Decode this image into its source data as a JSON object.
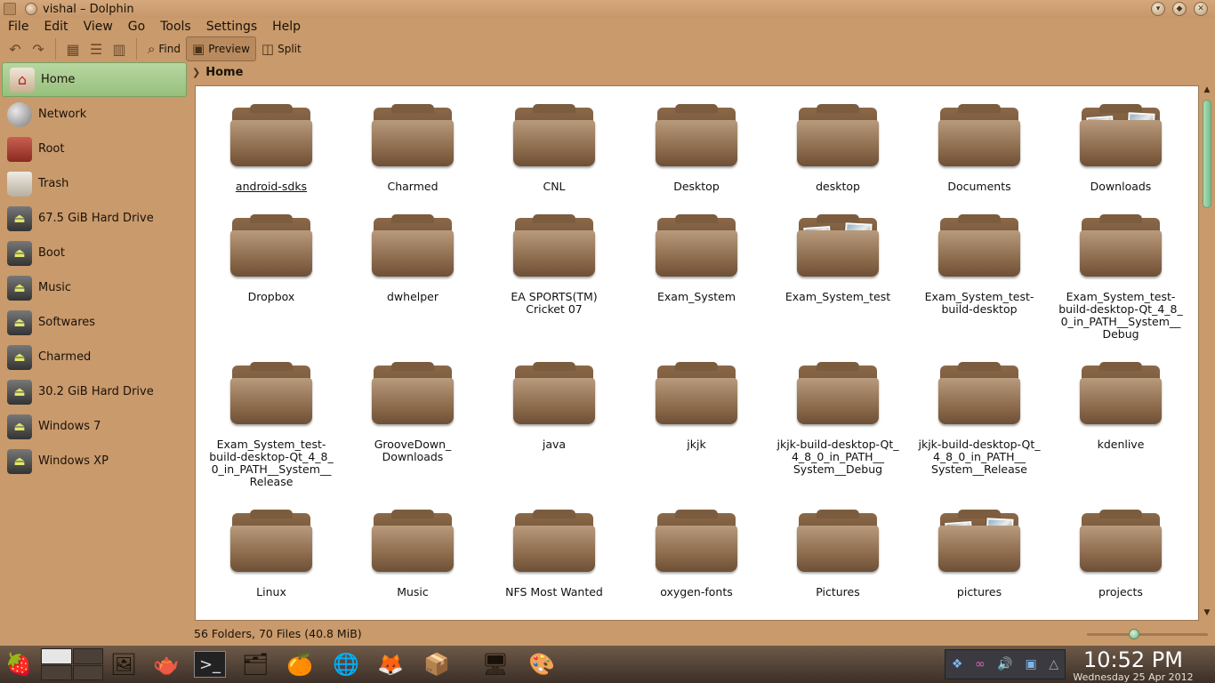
{
  "window": {
    "title": "vishal – Dolphin"
  },
  "menu": [
    "File",
    "Edit",
    "View",
    "Go",
    "Tools",
    "Settings",
    "Help"
  ],
  "toolbar": {
    "find": "Find",
    "preview": "Preview",
    "split": "Split"
  },
  "places": [
    {
      "label": "Home",
      "icon": "home-icon",
      "kind": "home"
    },
    {
      "label": "Network",
      "icon": "network-icon",
      "kind": "net"
    },
    {
      "label": "Root",
      "icon": "root-folder-icon",
      "kind": "root"
    },
    {
      "label": "Trash",
      "icon": "trash-icon",
      "kind": "trash"
    },
    {
      "label": "67.5 GiB Hard Drive",
      "icon": "hard-drive-icon",
      "kind": "drive"
    },
    {
      "label": "Boot",
      "icon": "hard-drive-icon",
      "kind": "drive"
    },
    {
      "label": "Music",
      "icon": "hard-drive-icon",
      "kind": "drive"
    },
    {
      "label": "Softwares",
      "icon": "hard-drive-icon",
      "kind": "drive"
    },
    {
      "label": "Charmed",
      "icon": "hard-drive-icon",
      "kind": "drive"
    },
    {
      "label": "30.2 GiB Hard Drive",
      "icon": "hard-drive-icon",
      "kind": "drive"
    },
    {
      "label": "Windows 7",
      "icon": "hard-drive-icon",
      "kind": "drive"
    },
    {
      "label": "Windows XP",
      "icon": "hard-drive-icon",
      "kind": "drive"
    }
  ],
  "breadcrumb": {
    "current": "Home"
  },
  "folders": [
    {
      "name": "android-sdks",
      "underline": true
    },
    {
      "name": "Charmed"
    },
    {
      "name": "CNL"
    },
    {
      "name": "Desktop"
    },
    {
      "name": "desktop"
    },
    {
      "name": "Documents"
    },
    {
      "name": "Downloads",
      "photos": true
    },
    {
      "name": "Dropbox"
    },
    {
      "name": "dwhelper"
    },
    {
      "name": "EA SPORTS(TM)\nCricket 07"
    },
    {
      "name": "Exam_System"
    },
    {
      "name": "Exam_System_test",
      "photos": true
    },
    {
      "name": "Exam_System_test-\nbuild-desktop"
    },
    {
      "name": "Exam_System_test-\nbuild-desktop-Qt_4_8_\n0_in_PATH__System__\nDebug"
    },
    {
      "name": "Exam_System_test-\nbuild-desktop-Qt_4_8_\n0_in_PATH__System__\nRelease"
    },
    {
      "name": "GrooveDown_\nDownloads"
    },
    {
      "name": "java"
    },
    {
      "name": "jkjk"
    },
    {
      "name": "jkjk-build-desktop-Qt_\n4_8_0_in_PATH__\nSystem__Debug"
    },
    {
      "name": "jkjk-build-desktop-Qt_\n4_8_0_in_PATH__\nSystem__Release"
    },
    {
      "name": "kdenlive"
    },
    {
      "name": "Linux"
    },
    {
      "name": "Music"
    },
    {
      "name": "NFS Most Wanted"
    },
    {
      "name": "oxygen-fonts"
    },
    {
      "name": "Pictures"
    },
    {
      "name": "pictures",
      "photos": true
    },
    {
      "name": "projects"
    }
  ],
  "status": {
    "summary": "56 Folders, 70 Files (40.8 MiB)",
    "zoom_level": 0.38
  },
  "taskbar": {
    "launchers": [
      "kickoff-menu-icon",
      "screenshot-app-icon",
      "teapot-app-icon",
      "terminal-icon",
      "archive-icon",
      "orange-app-icon",
      "chromium-icon",
      "fox-app-icon",
      "package-manager-icon",
      "dolphin-task-icon",
      "paint-task-icon"
    ]
  },
  "tray": {
    "icons": [
      "dropbox-icon",
      "network-icon",
      "volume-icon",
      "device-notifier-icon",
      "expand-tray-icon"
    ]
  },
  "clock": {
    "time": "10:52 PM",
    "date": "Wednesday 25 Apr 2012"
  },
  "colors": {
    "window_bg": "#c99a6c",
    "selection": "#97c07c",
    "view_bg": "#ffffff"
  }
}
